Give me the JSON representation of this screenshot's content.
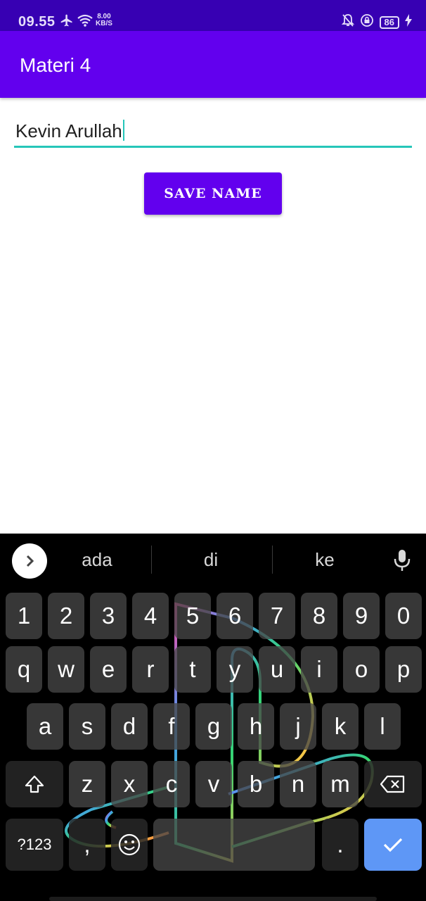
{
  "status_bar": {
    "time": "09.55",
    "net_speed_value": "8.00",
    "net_speed_unit": "KB/S",
    "battery": "86",
    "icons": [
      "airplane-icon",
      "wifi-icon",
      "notifications-off-icon",
      "lock-rotation-icon",
      "battery-icon",
      "charging-icon"
    ]
  },
  "app_bar": {
    "title": "Materi 4"
  },
  "form": {
    "name_value": "Kevin Arullah",
    "save_label": "SAVE NAME"
  },
  "colors": {
    "status_bar": "#3700b3",
    "app_bar": "#6200ee",
    "input_underline": "#26c6b9",
    "button": "#6200ee",
    "enter_key": "#5e97f6"
  },
  "keyboard": {
    "suggestions": [
      "ada",
      "di",
      "ke"
    ],
    "numbers": [
      "1",
      "2",
      "3",
      "4",
      "5",
      "6",
      "7",
      "8",
      "9",
      "0"
    ],
    "row1": [
      "q",
      "w",
      "e",
      "r",
      "t",
      "y",
      "u",
      "i",
      "o",
      "p"
    ],
    "row2": [
      "a",
      "s",
      "d",
      "f",
      "g",
      "h",
      "j",
      "k",
      "l"
    ],
    "row3": [
      "z",
      "x",
      "c",
      "v",
      "b",
      "n",
      "m"
    ],
    "symbols_label": "?123",
    "comma_label": ",",
    "period_label": "."
  }
}
